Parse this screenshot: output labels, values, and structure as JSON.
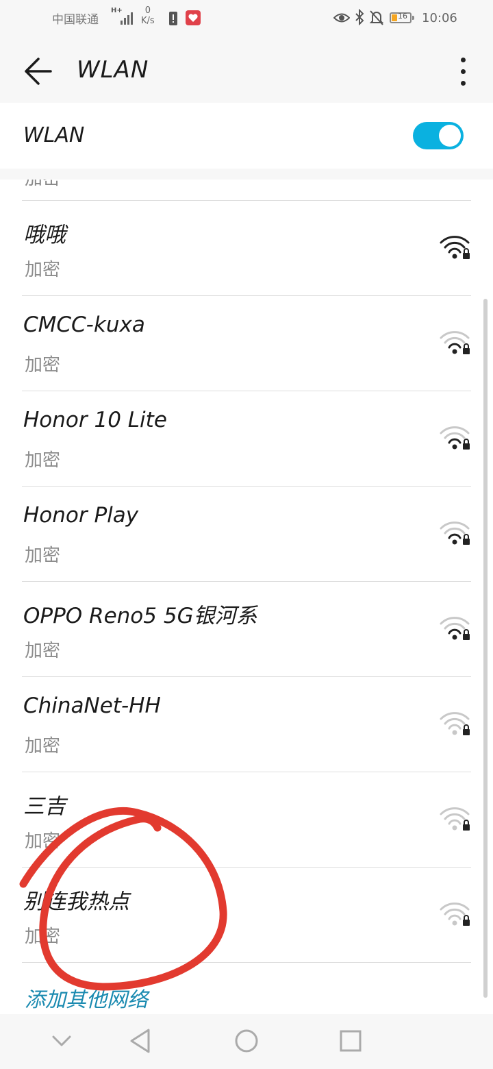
{
  "status_bar": {
    "carrier": "中国联通",
    "network_type": "H+",
    "speed_value": "0",
    "speed_unit": "K/s",
    "time": "10:06",
    "battery_level": "16",
    "icons": [
      "signal-icon",
      "alert-icon",
      "heart-app-icon",
      "eye-icon",
      "bluetooth-icon",
      "mute-bell-icon",
      "battery-icon"
    ]
  },
  "app_bar": {
    "back_icon": "arrow-left-icon",
    "title": "WLAN",
    "more_icon": "more-vertical-icon"
  },
  "wlan_toggle": {
    "label": "WLAN",
    "enabled": true,
    "accent_color": "#0ab1e0"
  },
  "networks": {
    "partial_top_subtitle": "加密",
    "items": [
      {
        "name": "哦哦",
        "subtitle": "加密",
        "signal": 3
      },
      {
        "name": "CMCC-kuxa",
        "subtitle": "加密",
        "signal": 1
      },
      {
        "name": "Honor 10 Lite",
        "subtitle": "加密",
        "signal": 1
      },
      {
        "name": "Honor Play",
        "subtitle": "加密",
        "signal": 1
      },
      {
        "name": "OPPO Reno5 5G银河系",
        "subtitle": "加密",
        "signal": 1
      },
      {
        "name": "ChinaNet-HH",
        "subtitle": "加密",
        "signal": 0
      },
      {
        "name": "三吉",
        "subtitle": "加密",
        "signal": 0
      },
      {
        "name": "别连我热点",
        "subtitle": "加密",
        "signal": 0
      }
    ]
  },
  "add_network_label": "添加其他网络",
  "nav_bar": {
    "buttons": [
      "collapse-down-icon",
      "back-triangle-icon",
      "home-circle-icon",
      "recents-square-icon"
    ]
  },
  "annotation_color": "#e23a2f"
}
